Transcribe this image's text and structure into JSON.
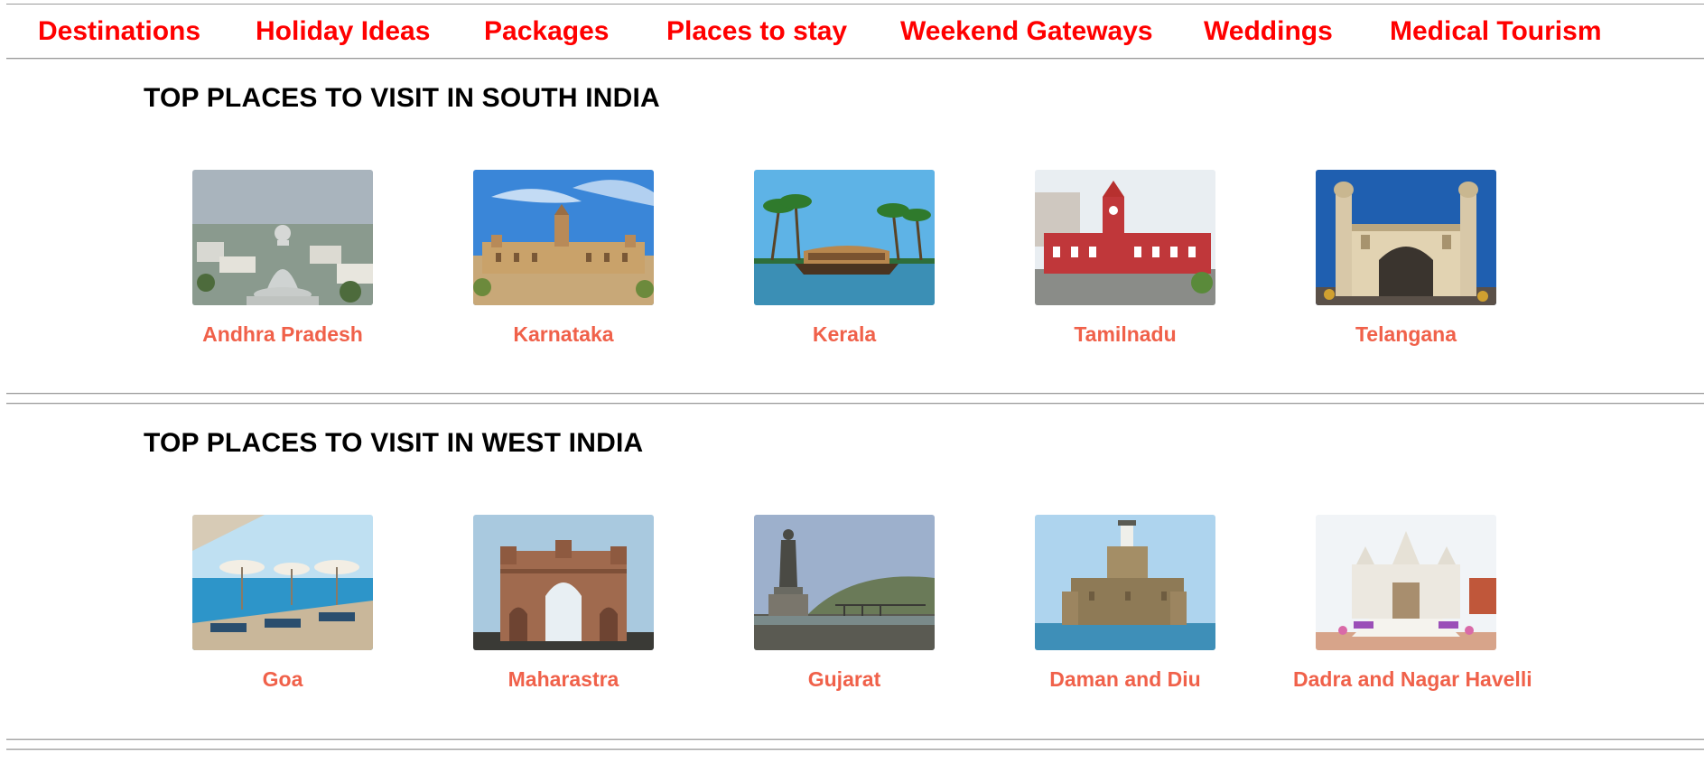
{
  "nav": {
    "items": [
      {
        "label": "Destinations"
      },
      {
        "label": "Holiday Ideas"
      },
      {
        "label": "Packages"
      },
      {
        "label": "Places to stay"
      },
      {
        "label": "Weekend Gateways"
      },
      {
        "label": "Weddings"
      },
      {
        "label": "Medical Tourism"
      }
    ]
  },
  "sections": [
    {
      "title": "TOP PLACES TO VISIT IN SOUTH INDIA",
      "places": [
        {
          "name": "Andhra Pradesh",
          "image": "buddha-statue-image"
        },
        {
          "name": "Karnataka",
          "image": "palace-image"
        },
        {
          "name": "Kerala",
          "image": "houseboat-image"
        },
        {
          "name": "Tamilnadu",
          "image": "railway-station-image"
        },
        {
          "name": "Telangana",
          "image": "charminar-image"
        }
      ]
    },
    {
      "title": "TOP PLACES TO VISIT IN WEST INDIA",
      "places": [
        {
          "name": "Goa",
          "image": "beach-resort-image"
        },
        {
          "name": "Maharastra",
          "image": "gateway-of-india-image"
        },
        {
          "name": "Gujarat",
          "image": "statue-of-unity-image"
        },
        {
          "name": "Daman and Diu",
          "image": "sea-fort-image"
        },
        {
          "name": "Dadra and Nagar Havelli",
          "image": "white-temple-image"
        }
      ]
    }
  ],
  "colors": {
    "nav_text": "#ff0000",
    "place_label": "#f0614a",
    "heading": "#000000",
    "divider": "#9a9a9a"
  }
}
